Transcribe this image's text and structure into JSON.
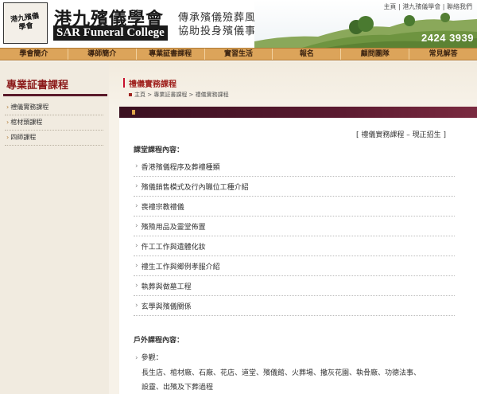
{
  "header": {
    "logo_seal": "港九殯儀學會",
    "brand_zh": "港九殯儀學會",
    "brand_en": "SAR Funeral College",
    "tagline_line1": "傳承殯儀殮葬風俗",
    "tagline_line2": "協助投身殯儀事務",
    "phone": "2424 3939",
    "top_links": [
      "主頁",
      "港九殯儀學會",
      "聯絡我們"
    ]
  },
  "nav": {
    "items": [
      "學會簡介",
      "導師簡介",
      "專業証書課程",
      "實習生活",
      "報名",
      "顧問團隊",
      "常見解答"
    ]
  },
  "sidebar": {
    "title": "專業証書課程",
    "items": [
      "禮儀實務課程",
      "棺材頭課程",
      "四師課程"
    ]
  },
  "main": {
    "title": "禮儀實務課程",
    "breadcrumb": "主頁 > 專業証書課程 > 禮儀實務課程",
    "status": "[ 禮儀實務課程 – 現正招生 ]",
    "classroom_heading": "課堂課程內容：",
    "courses": [
      "香港殯儀程序及葬禮種類",
      "殯儀銷售模式及行內職位工種介紹",
      "喪禮宗教禮儀",
      "殯殮用品及靈堂佈置",
      "仵工工作與遺體化妝",
      "禮生工作與鄉例孝服介紹",
      "執葬與做墓工程",
      "玄學與殯儀關係"
    ],
    "outdoor_heading": "戶外課程內容：",
    "outdoor_sub": "參觀：",
    "outdoor_line1": "長生店、棺材廠、石廠、花店、道堂、殯儀館、火葬場、撒灰花園、執骨廠、功德法事、",
    "outdoor_line2": "設靈、出殯及下葬過程"
  },
  "colors": {
    "nav_bg": "#dca45a",
    "accent_red": "#a0231f",
    "panel_head": "#3a1020",
    "sidebar_rule": "#5a1a2a"
  }
}
